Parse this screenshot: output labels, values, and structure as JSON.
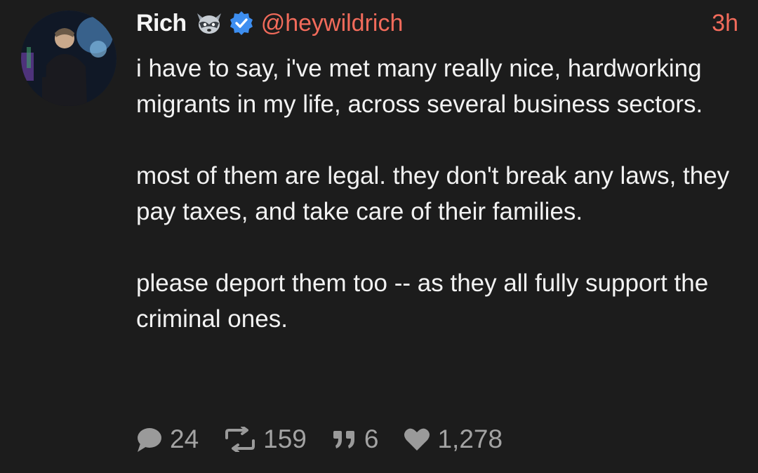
{
  "author": {
    "name": "Rich",
    "handle": "@heywildrich",
    "time": "3h",
    "emoji_icon": "raccoon-icon",
    "verified_icon": "verified-badge-icon",
    "verified_color": "#3d8ef0",
    "accent_color": "#f26b5b"
  },
  "post": {
    "paragraphs": [
      "i have to say, i've met many really nice, hardworking migrants in my life, across several business sectors.",
      "most of them are legal. they don't break any laws, they pay taxes, and take care of their families.",
      "please deport them too -- as they all fully support the criminal ones."
    ]
  },
  "actions": {
    "replies": "24",
    "reposts": "159",
    "quotes": "6",
    "likes": "1,278"
  }
}
